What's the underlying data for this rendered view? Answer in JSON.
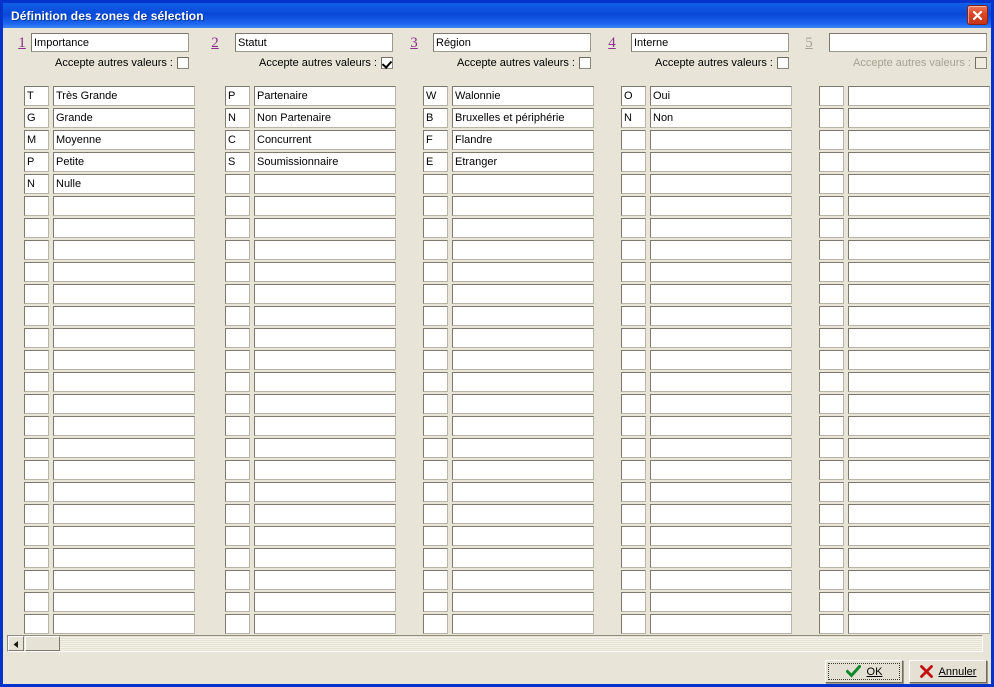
{
  "window": {
    "title": "Définition des zones de sélection",
    "close_icon": "close-icon",
    "accent_titlebar": "#0a48d8",
    "accent_number": "#8d2f8d",
    "background": "#e8e4d7"
  },
  "accepte_label": "Accepte autres valeurs :",
  "columns": [
    {
      "number": "1",
      "name": "Importance",
      "accepte_label": "Accepte autres valeurs :",
      "accepte_checked": false,
      "disabled": false,
      "rows": [
        {
          "code": "T",
          "value": "Très Grande"
        },
        {
          "code": "G",
          "value": "Grande"
        },
        {
          "code": "M",
          "value": "Moyenne"
        },
        {
          "code": "P",
          "value": "Petite"
        },
        {
          "code": "N",
          "value": "Nulle"
        }
      ]
    },
    {
      "number": "2",
      "name": "Statut",
      "accepte_label": "Accepte autres valeurs :",
      "accepte_checked": true,
      "disabled": false,
      "rows": [
        {
          "code": "P",
          "value": "Partenaire"
        },
        {
          "code": "N",
          "value": "Non Partenaire"
        },
        {
          "code": "C",
          "value": "Concurrent"
        },
        {
          "code": "S",
          "value": "Soumissionnaire"
        }
      ]
    },
    {
      "number": "3",
      "name": "Région",
      "accepte_label": "Accepte autres valeurs :",
      "accepte_checked": false,
      "disabled": false,
      "rows": [
        {
          "code": "W",
          "value": "Walonnie"
        },
        {
          "code": "B",
          "value": "Bruxelles et périphérie"
        },
        {
          "code": "F",
          "value": "Flandre"
        },
        {
          "code": "E",
          "value": "Etranger"
        }
      ]
    },
    {
      "number": "4",
      "name": "Interne",
      "accepte_label": "Accepte autres valeurs :",
      "accepte_checked": false,
      "disabled": false,
      "rows": [
        {
          "code": "O",
          "value": "Oui"
        },
        {
          "code": "N",
          "value": "Non"
        }
      ]
    },
    {
      "number": "5",
      "name": "",
      "accepte_label": "Accepte autres valeurs :",
      "accepte_checked": false,
      "disabled": true,
      "rows": []
    }
  ],
  "grid": {
    "visible_rows": 25
  },
  "scrollbar": {
    "left_arrow_icon": "arrow-left-icon"
  },
  "footer": {
    "ok_label": "OK",
    "ok_icon": "check-icon",
    "cancel_label": "Annuler",
    "cancel_icon": "cross-icon"
  }
}
